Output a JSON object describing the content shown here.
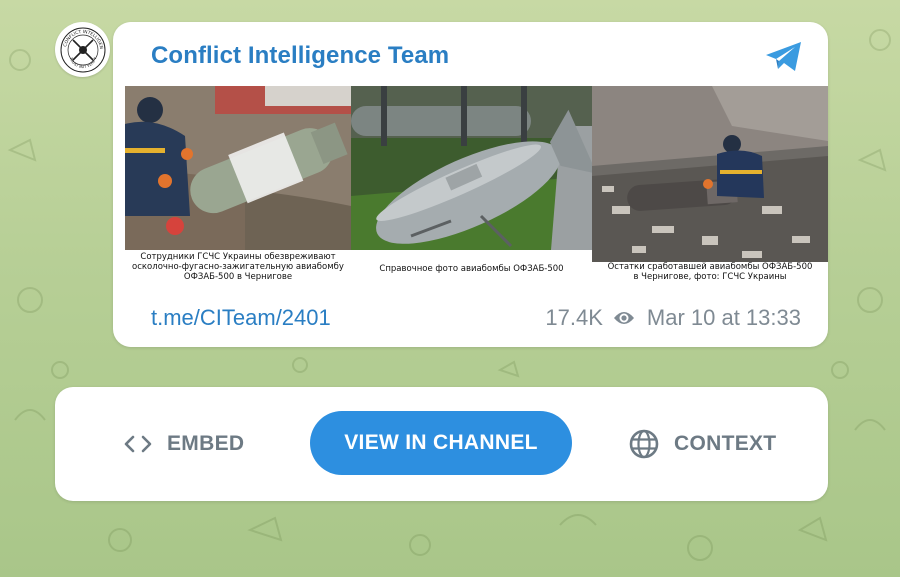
{
  "channel": {
    "name": "Conflict Intelligence Team",
    "avatar_lines": [
      "CONFLICT INTELLIGENCE TEAM",
      "TRUST BUT VERIFY"
    ]
  },
  "post": {
    "link": "t.me/CITeam/2401",
    "views": "17.4K",
    "date": "Mar 10 at 13:33",
    "photos": [
      {
        "caption": "Сотрудники ГСЧС Украины обезвреживают\nосколочно-фугасно-зажигательную авиабомбу\nОФЗАБ-500 в Чернигове"
      },
      {
        "caption": "Справочное фото авиабомбы ОФЗАБ-500"
      },
      {
        "caption": "Остатки сработавшей авиабомбы ОФЗАБ-500\nв Чернигове, фото: ГСЧС Украины"
      }
    ]
  },
  "actions": {
    "embed": "EMBED",
    "view_in_channel": "VIEW IN CHANNEL",
    "context": "CONTEXT"
  },
  "colors": {
    "accent": "#2a7ec3",
    "button": "#2d8fe0",
    "muted": "#7f8a93",
    "background": "#b7cf96"
  },
  "icons": {
    "telegram": "telegram-icon",
    "views": "eye-icon",
    "embed": "code-icon",
    "context": "globe-icon"
  }
}
